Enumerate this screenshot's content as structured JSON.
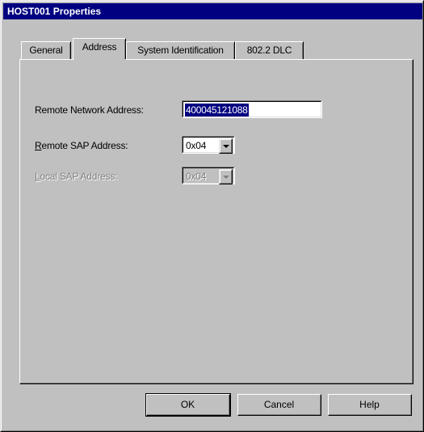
{
  "window": {
    "title": "HOST001 Properties"
  },
  "tabs": [
    {
      "label": "General",
      "active": false
    },
    {
      "label": "Address",
      "active": true
    },
    {
      "label": "System Identification",
      "active": false
    },
    {
      "label": "802.2 DLC",
      "active": false
    }
  ],
  "address": {
    "remote_network_label": "Remote Network Address:",
    "remote_network_value": "400045121088",
    "remote_sap_label_rest": "emote SAP Address:",
    "remote_sap_label_access": "R",
    "remote_sap_value": "0x04",
    "local_sap_label_rest": "ocal SAP Address:",
    "local_sap_label_access": "L",
    "local_sap_value": "0x04"
  },
  "buttons": {
    "ok": "OK",
    "cancel": "Cancel",
    "help": "Help"
  }
}
